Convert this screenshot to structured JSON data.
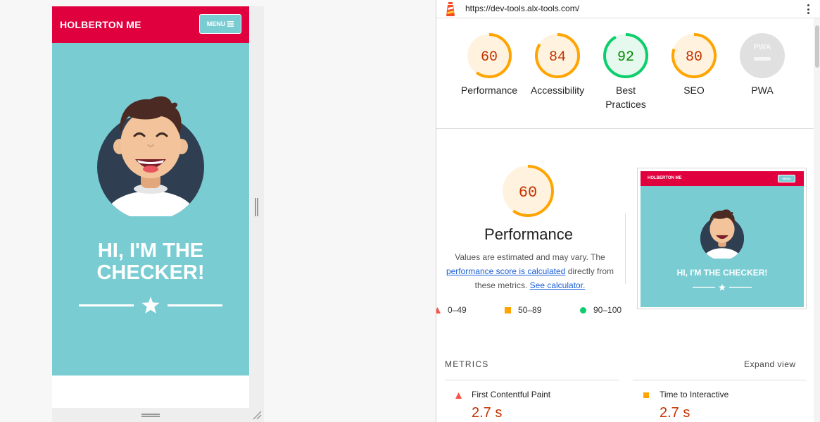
{
  "site": {
    "brand": "HOLBERTON ME",
    "menu_label": "MENU",
    "hero_title_line1": "HI, I'M THE",
    "hero_title_line2": "CHECKER!",
    "thumbnail_title": "HI, I'M THE CHECKER!",
    "colors": {
      "header": "#e1003e",
      "hero": "#7accd3"
    }
  },
  "devtools": {
    "url": "https://dev-tools.alx-tools.com/",
    "scores": [
      {
        "label": "Performance",
        "value": "60",
        "score": 60,
        "status": "average"
      },
      {
        "label": "Accessibility",
        "value": "84",
        "score": 84,
        "status": "average"
      },
      {
        "label": "Best Practices",
        "value": "92",
        "score": 92,
        "status": "pass"
      },
      {
        "label": "SEO",
        "value": "80",
        "score": 80,
        "status": "average"
      },
      {
        "label": "PWA",
        "value": "PWA",
        "score": null,
        "status": "not-applicable"
      }
    ],
    "performance": {
      "score": "60",
      "title": "Performance",
      "desc_part1": "Values are estimated and may vary. The",
      "desc_link1": "performance score is calculated",
      "desc_part2": "directly from these metrics.",
      "desc_link2": "See calculator."
    },
    "legend": [
      {
        "range": "0–49",
        "shape": "triangle",
        "color": "#ff4e42"
      },
      {
        "range": "50–89",
        "shape": "square",
        "color": "#ffa400"
      },
      {
        "range": "90–100",
        "shape": "circle",
        "color": "#0cce6b"
      }
    ],
    "metrics_label": "METRICS",
    "expand_label": "Expand view",
    "metrics": [
      {
        "name": "First Contentful Paint",
        "value": "2.7 s",
        "status": "fail"
      },
      {
        "name": "Time to Interactive",
        "value": "2.7 s",
        "status": "average"
      }
    ],
    "status_colors": {
      "fail": "#ff4e42",
      "average": "#ffa400",
      "pass": "#0cce6b",
      "na": "#e0e0e0"
    }
  }
}
